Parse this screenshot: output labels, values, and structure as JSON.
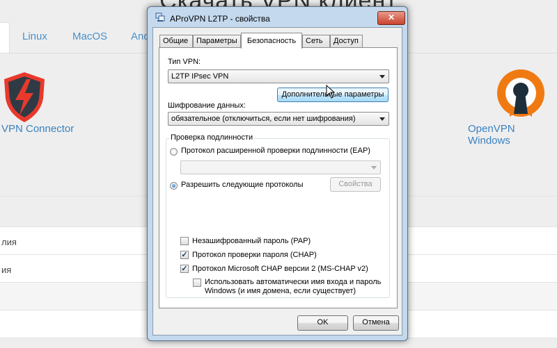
{
  "background_page": {
    "heading": "Скачать VPN клиент",
    "tabs": [
      "Linux",
      "MacOS",
      "And"
    ],
    "left_client_caption": "VPN Connector",
    "right_client_caption": "OpenVPN Windows",
    "rows": [
      "лия",
      "ия"
    ]
  },
  "dialog": {
    "title": "AProVPN L2TP - свойства",
    "close_glyph": "✕",
    "tabs": [
      "Общие",
      "Параметры",
      "Безопасность",
      "Сеть",
      "Доступ"
    ],
    "active_tab": "Безопасность",
    "vpn_type_label": "Тип VPN:",
    "vpn_type_value": "L2TP IPsec VPN",
    "advanced_button": "Дополнительные параметры",
    "encryption_label": "Шифрование данных:",
    "encryption_value": "обязательное (отключиться, если нет шифрования)",
    "auth_group_title": "Проверка подлинности",
    "eap_radio": "Протокол расширенной проверки подлинности (EAP)",
    "eap_radio_checked": false,
    "allow_radio": "Разрешить следующие протоколы",
    "allow_radio_checked": true,
    "properties_button": "Свойства",
    "protocols": [
      {
        "label": "Незашифрованный пароль (PAP)",
        "checked": false
      },
      {
        "label": "Протокол проверки пароля (CHAP)",
        "checked": true
      },
      {
        "label": "Протокол Microsoft CHAP версии 2 (MS-CHAP v2)",
        "checked": true
      }
    ],
    "auto_login_line1": "Использовать автоматически имя входа и пароль",
    "auto_login_line2": "Windows (и имя домена, если существует)",
    "auto_login_checked": false,
    "ok_button": "OK",
    "cancel_button": "Отмена"
  },
  "colors": {
    "link_blue": "#3a82c0",
    "window_frame": "#c4d9ee",
    "close_red": "#c8432e",
    "logo_red": "#e8392c",
    "logo_orange": "#f07a12"
  },
  "icons": {
    "left_logo": "shield-lightning-icon",
    "right_logo": "openvpn-keyhole-icon",
    "title_icon": "network-connection-icon",
    "cursor": "mouse-pointer-icon"
  }
}
